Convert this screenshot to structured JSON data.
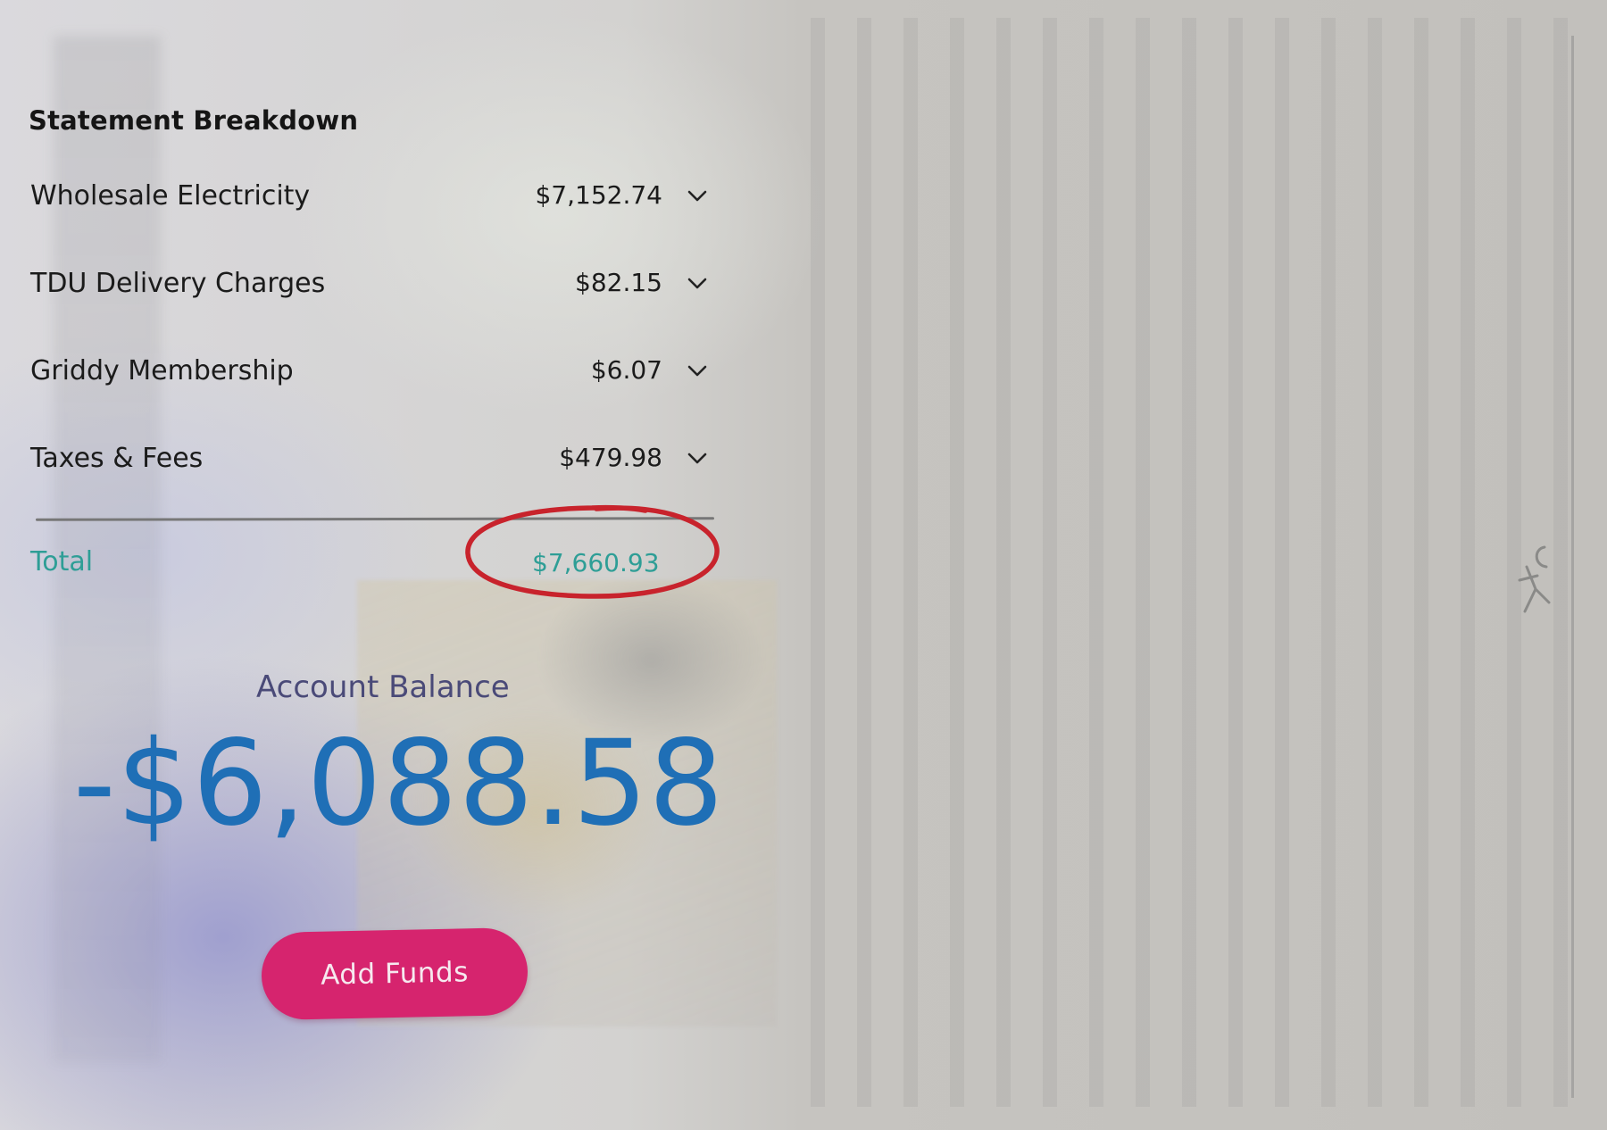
{
  "statement": {
    "title": "Statement Breakdown",
    "items": [
      {
        "label": "Wholesale Electricity",
        "amount": "$7,152.74"
      },
      {
        "label": "TDU Delivery Charges",
        "amount": "$82.15"
      },
      {
        "label": "Griddy Membership",
        "amount": "$6.07"
      },
      {
        "label": "Taxes & Fees",
        "amount": "$479.98"
      }
    ],
    "total_label": "Total",
    "total_amount": "$7,660.93",
    "expand_icon": "chevron-down-icon"
  },
  "balance": {
    "label": "Account Balance",
    "amount": "-$6,088.58"
  },
  "actions": {
    "add_funds_label": "Add Funds"
  },
  "colors": {
    "accent_teal": "#2e9e96",
    "balance_blue": "#1f6fb6",
    "button_pink": "#d6246e",
    "annotation_red": "#c8232c",
    "label_purple": "#4a4a78"
  }
}
